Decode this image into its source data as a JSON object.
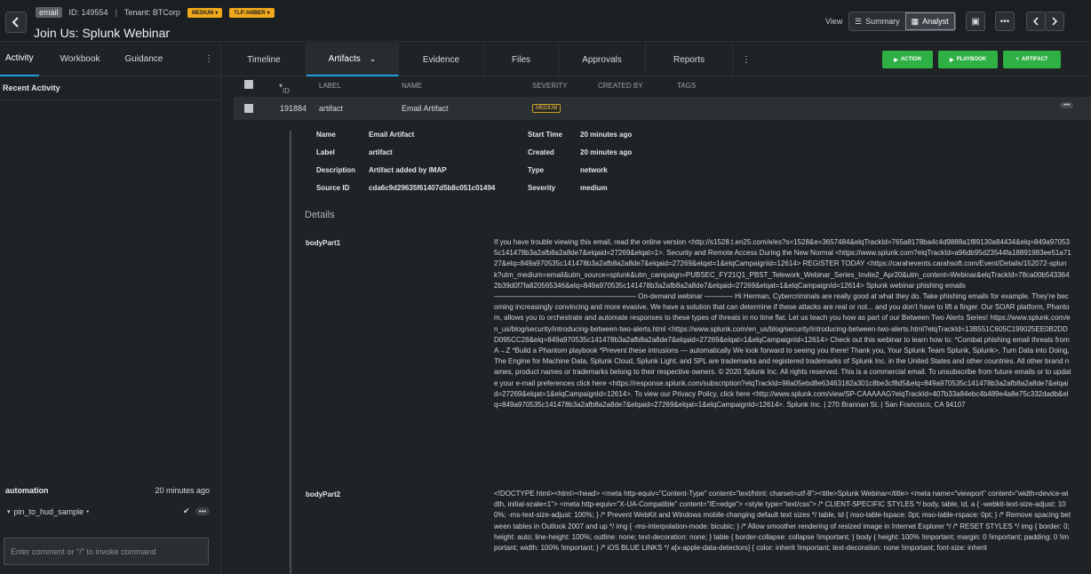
{
  "header": {
    "type_tag": "email",
    "id": "ID: 149554",
    "separator": "|",
    "tenant": "Tenant: BTCorp",
    "severity_badge": "MEDIUM",
    "tlp_badge": "TLP:AMBER",
    "title": "Join Us: Splunk Webinar",
    "view_label": "View",
    "view_summary": "Summary",
    "view_analyst": "Analyst"
  },
  "left": {
    "tabs": [
      "Activity",
      "Workbook",
      "Guidance"
    ],
    "recent_activity": "Recent Activity",
    "automation_label": "automation",
    "automation_time": "20 minutes ago",
    "pin_name": "pin_to_hud_sample",
    "comment_placeholder": "Enter comment or \"/\" to invoke command"
  },
  "tabs": {
    "timeline": "Timeline",
    "artifacts": "Artifacts",
    "evidence": "Evidence",
    "files": "Files",
    "approvals": "Approvals",
    "reports": "Reports",
    "action": "ACTION",
    "playbook": "PLAYBOOK",
    "artifact": "ARTIFACT"
  },
  "table": {
    "headers": {
      "id": "ID",
      "label": "LABEL",
      "name": "NAME",
      "severity": "SEVERITY",
      "created_by": "CREATED BY",
      "tags": "TAGS"
    },
    "row": {
      "id": "191884",
      "label": "artifact",
      "name": "Email Artifact",
      "severity": "MEDIUM"
    }
  },
  "artifact": {
    "name_k": "Name",
    "name_v": "Email Artifact",
    "label_k": "Label",
    "label_v": "artifact",
    "desc_k": "Description",
    "desc_v": "Artifact added by IMAP",
    "src_k": "Source ID",
    "src_v": "cda6c9d29635f61407d5b8c051c01494",
    "start_k": "Start Time",
    "start_v": "20 minutes ago",
    "created_k": "Created",
    "created_v": "20 minutes ago",
    "type_k": "Type",
    "type_v": "network",
    "sev_k": "Severity",
    "sev_v": "medium"
  },
  "details": {
    "heading": "Details",
    "body1_label": "bodyPart1",
    "body1": "If you have trouble viewing this email, read the online version <http://s1528.t.en25.com/e/es?s=1528&e=3657484&elqTrackId=765a8178ba4c4d9888a1f89130a84434&elq=849a970535c141478b3a2afb8a2a8de7&elqaid=27269&elqat=1>. Security and Remote Access During the New Normal <https://www.splunk.com?elqTrackId=a96db95d23544fa18891983ee51a7127&elq=849a970535c141478b3a2afb8a2a8de7&elqaid=27269&elqat=1&elqCampaignId=12614> REGISTER TODAY <https://carahevents.carahsoft.com/Event/Details/152072-splunk?utm_medium=email&utm_source=splunk&utm_campaign=PUBSEC_FY21Q1_PBST_Telework_Webinar_Series_Invite2_Apr20&utm_content=Webinar&elqTrackId=78ca00b5433642b39d0f7fa820565346&elq=849a970535c141478b3a2afb8a2a8de7&elqaid=27269&elqat=1&elqCampaignId=12614> Splunk webinar phishing emails ———————————————————— On-demand webinar ———— Hi Herman, Cybercriminals are really good at what they do. Take phishing emails for example. They're becoming increasingly convincing and more evasive. We have a solution that can determine if these attacks are real or not... and you don't have to lift a finger. Our SOAR platform, Phantom, allows you to orchestrate and automate responses to these types of threats in no time flat. Let us teach you how as part of our Between Two Alerts Series! https://www.splunk.com/en_us/blog/security/introducing-between-two-alerts.html <https://www.splunk.com/en_us/blog/security/introducing-between-two-alerts.html?elqTrackId=13B551C605C199025EE0B2DDD095CC28&elq=849a970535c141478b3a2afb8a2a8de7&elqaid=27269&elqat=1&elqCampaignId=12614> Check out this webinar to learn how to: *Combat phishing email threats from A→Z *Build a Phantom playbook *Prevent these intrusions — automatically We look forward to seeing you there! Thank you, Your Splunk Team Splunk, Splunk>, Turn Data into Doing, The Engine for Machine Data, Splunk Cloud, Splunk Light, and SPL are trademarks and registered trademarks of Splunk Inc. in the United States and other countries. All other brand names, product names or trademarks belong to their respective owners. © 2020 Splunk Inc. All rights reserved. This is a commercial email. To unsubscribe from future emails or to update your e-mail preferences click here <https://response.splunk.com/subscription?elqTrackId=98a05ebd8e63463182a301c8be3cf8d5&elq=849a970535c141478b3a2afb8a2a8de7&elqaid=27269&elqat=1&elqCampaignId=12614>. To view our Privacy Policy, click here <http://www.splunk.com/view/SP-CAAAAAG?elqTrackId=407b33a84ebc4b489e4a8e75c332dadb&elq=849a970535c141478b3a2afb8a2a8de7&elqaid=27269&elqat=1&elqCampaignId=12614>. Splunk Inc. | 270 Brannan St. | San Francisco, CA 94107",
    "body2_label": "bodyPart2",
    "body2": "<!DOCTYPE html><html><head> <meta http-equiv=\"Content-Type\" content=\"text/html; charset=utf-8\"><title>Splunk Webinar</title> <meta name=\"viewport\" content=\"width=device-width, initial-scale=1\"> <meta http-equiv=\"X-UA-Compatible\" content=\"IE=edge\"> <style type=\"text/css\"> /* CLIENT-SPECIFIC STYLES */ body, table, td, a { -webkit-text-size-adjust: 100%; -ms-text-size-adjust: 100%; } /* Prevent WebKit and Windows mobile changing default text sizes */ table, td { mso-table-lspace: 0pt; mso-table-rspace: 0pt; } /* Remove spacing between tables in Outlook 2007 and up */ img { -ms-interpolation-mode: bicubic; } /* Allow smoother rendering of resized image in Internet Explorer */ /* RESET STYLES */ img { border: 0; height: auto; line-height: 100%; outline: none; text-decoration: none; } table { border-collapse: collapse !important; } body { height: 100% !important; margin: 0 !important; padding: 0 !important; width: 100% !important; } /* iOS BLUE LINKS */ a[x-apple-data-detectors] { color: inherit !important; text-decoration: none !important; font-size: inherit"
  }
}
